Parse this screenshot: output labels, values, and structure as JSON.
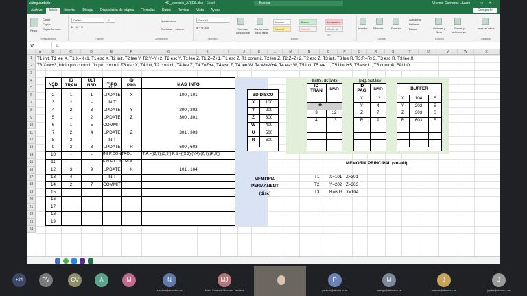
{
  "excel": {
    "title_bar": {
      "autosave": "Autoguardado",
      "file_name": "HC_ejercicio_ARIES.xlsx - Excel",
      "search_placeholder": "Buscar",
      "user": "Vicente Carneros Lázaro"
    },
    "tabs": [
      "Archivo",
      "Inicio",
      "Insertar",
      "Dibujar",
      "Disposición de página",
      "Fórmulas",
      "Datos",
      "Revisar",
      "Vista",
      "Ayuda"
    ],
    "share_label": "Compartir",
    "ribbon": {
      "clipboard": {
        "paste": "Pegar",
        "cut": "Cortar",
        "copy": "Copiar",
        "format_painter": "Copiar formato",
        "label": "Portapapeles"
      },
      "font": {
        "name": "Calibri",
        "size": "11",
        "label": "Fuente"
      },
      "alignment": {
        "wrap": "Ajustar texto",
        "merge": "Combinar y centrar",
        "label": "Alineación"
      },
      "number": {
        "format": "General",
        "label": "Número"
      },
      "styles": {
        "normal": "Normal",
        "bueno": "Bueno",
        "incorrecto": "Incorrecto",
        "neutral": "Neutral",
        "calculo": "Cálculo",
        "celda_vinculada": "Celda de co...",
        "cond_format": "Formato condicional",
        "as_table": "Dar formato como tabla",
        "label": "Estilos"
      },
      "cells": {
        "insert": "Insertar",
        "delete": "Eliminar",
        "format": "Formato",
        "label": "Celdas"
      },
      "editing": {
        "autosum": "Autosuma",
        "fill": "Rellenar",
        "clear": "Borrar",
        "sort": "Ordenar y filtrar",
        "find": "Buscar y seleccionar",
        "label": "Edición"
      },
      "analyze": {
        "label": "Analizar datos",
        "group": "Análisis"
      }
    },
    "name_box": "N7",
    "fx": "fx",
    "columns": [
      "A",
      "B",
      "C",
      "D",
      "E",
      "F",
      "G",
      "H",
      "I",
      "J",
      "K",
      "L",
      "M",
      "N",
      "O",
      "P",
      "Q",
      "R",
      "S",
      "T",
      "U",
      "V",
      "W",
      "X"
    ],
    "rows": [
      "1",
      "2",
      "3",
      "4",
      "5",
      "6",
      "7",
      "8",
      "9",
      "10",
      "11",
      "12",
      "13",
      "14",
      "15",
      "16",
      "17",
      "18",
      "19",
      "20",
      "21",
      "22",
      "23",
      "24"
    ],
    "line1": "T1 init, T1 lee X, T1:X=X+1, T1 esc X, T2 init, T2 lee Y, T2:Y=Y+2, T2 esc Y, T1 lee Z, T1:Z=Z+1, T1 esc Z, T1 commit, T2 lee Z, T2:Z=Z+2, T2 esc Z, T3 init, T3 lee R, T3:R=R+3, T3 esc R, T3 lee X,",
    "line2": "T3:X=X+3, inicio pto.control, fin pto.control, T3 esc X, T4 init, T2 commit, T4 lee Z, T4:Z=Z+4, T4 esc Z, T4 lee W, T4:W=W+4, T4 esc W, T5 init, T5 lee U, T5:U=U+5, T5 esc U, T5 commit, FALLO",
    "log_table": {
      "headers": [
        "NSD",
        "ID\nTRAN",
        "ULT\nNSD",
        "TIPO",
        "ID\nPAG",
        "MAS_INFO"
      ],
      "header_lines": [
        [
          "NSD"
        ],
        [
          "ID",
          "TRAN"
        ],
        [
          "ULT",
          "NSD"
        ],
        [
          "TIPO"
        ],
        [
          "ID",
          "PAG"
        ],
        [
          "MAS_INFO"
        ]
      ],
      "rows": [
        [
          "1",
          "1",
          "-",
          "INIT",
          "",
          ""
        ],
        [
          "2",
          "1",
          "1",
          "UPDATE",
          "X",
          "100 , 101"
        ],
        [
          "3",
          "2",
          "-",
          "INIT",
          "",
          ""
        ],
        [
          "4",
          "2",
          "3",
          "UPDATE",
          "Y",
          "200 , 202"
        ],
        [
          "5",
          "1",
          "2",
          "UPDATE",
          "Z",
          "300 , 301"
        ],
        [
          "6",
          "1",
          "5",
          "COMMIT",
          "",
          ""
        ],
        [
          "7",
          "2",
          "4",
          "UPDATE",
          "Z",
          "301 , 303"
        ],
        [
          "8",
          "3",
          "-",
          "INIT",
          "",
          ""
        ],
        [
          "9",
          "3",
          "8",
          "UPDATE",
          "R",
          "600 , 603"
        ],
        [
          "10",
          "-",
          "-",
          "INI P.CONTROL",
          "",
          "T.A.={(2,7),(3,9)} P.S.={(X,2),(Y,4),(Z,7),(R,9)}"
        ],
        [
          "11",
          "-",
          "-",
          "FIN P.CONTROL",
          "",
          ""
        ],
        [
          "12",
          "3",
          "9",
          "UPDATE",
          "X",
          "101 , 104"
        ],
        [
          "13",
          "4",
          "-",
          "INIT",
          "",
          ""
        ],
        [
          "14",
          "2",
          "7",
          "COMMIT",
          "",
          ""
        ],
        [
          "15",
          "",
          "",
          "",
          "",
          ""
        ],
        [
          "16",
          "",
          "",
          "",
          "",
          ""
        ],
        [
          "17",
          "",
          "",
          "",
          "",
          ""
        ],
        [
          "18",
          "",
          "",
          "",
          "",
          ""
        ],
        [
          "19",
          "",
          "",
          "",
          "",
          ""
        ]
      ]
    },
    "bd_disco": {
      "title": "BD DISCO",
      "rows": [
        [
          "X",
          "100"
        ],
        [
          "Y",
          "200"
        ],
        [
          "Z",
          "300"
        ],
        [
          "W",
          "400"
        ],
        [
          "U",
          "500"
        ],
        [
          "R",
          "600"
        ]
      ]
    },
    "memoria_permanente": [
      "MEMORIA",
      "PERMANENT",
      "(disc)"
    ],
    "trans_activas": {
      "title": "trans. activas",
      "headers": [
        [
          "ID",
          "TRAN"
        ],
        [
          "NSD"
        ]
      ],
      "rows": [
        [
          "",
          ""
        ],
        [
          "",
          ""
        ],
        [
          "3",
          "12"
        ],
        [
          "4",
          "13"
        ],
        [
          "",
          ""
        ],
        [
          "",
          ""
        ],
        [
          "",
          ""
        ]
      ]
    },
    "pag_sucias": {
      "title": "pag. sucias",
      "headers": [
        [
          "ID",
          "PAG"
        ],
        [
          "NSD"
        ]
      ],
      "rows": [
        [
          "X",
          "12"
        ],
        [
          "Y",
          "4"
        ],
        [
          "Z",
          "7"
        ],
        [
          "R",
          "9"
        ],
        [
          "",
          ""
        ],
        [
          "",
          ""
        ],
        [
          "",
          ""
        ]
      ]
    },
    "buffer": {
      "title": "BUFFER",
      "rows": [
        [
          "X",
          "104",
          "S"
        ],
        [
          "Y",
          "202",
          "S"
        ],
        [
          "Z",
          "303",
          "S"
        ],
        [
          "R",
          "603",
          "S"
        ],
        [
          "",
          "",
          ""
        ],
        [
          "",
          "",
          ""
        ],
        [
          "",
          "",
          ""
        ]
      ]
    },
    "memoria_principal": {
      "title": "MEMORIA PRINCIPAL (volátil)",
      "rows": [
        [
          "T1",
          "X=101",
          "Z=301"
        ],
        [
          "T2",
          "Y=202",
          "Z=303"
        ],
        [
          "T3",
          "R=603",
          "X=104"
        ]
      ]
    }
  },
  "meeting": {
    "overflow": "+24",
    "participants": [
      {
        "initials": "PV",
        "color": "#7b7b7b",
        "name": ""
      },
      {
        "initials": "GV",
        "color": "#8e8e6a",
        "name": ""
      },
      {
        "initials": "A",
        "color": "#5aa58a",
        "name": ""
      },
      {
        "initials": "M",
        "color": "#c06a8e",
        "name": ""
      },
      {
        "initials": "N",
        "color": "#5f7aa8",
        "name": "zaschna@alumni.uv.es"
      },
      {
        "initials": "MJ",
        "color": "#b07878",
        "name": "María Consuelo Manzano Jabalera"
      },
      {
        "initials": "",
        "color": "#555",
        "name": ""
      },
      {
        "initials": "P",
        "color": "#6a82b5",
        "name": "paulvain@alumni.uv.es"
      },
      {
        "initials": "M",
        "color": "#7b8a9b",
        "name": "miesge@alumni.uv.es"
      },
      {
        "initials": "J",
        "color": "#c8a45a",
        "name": "jortecer@alumni.uv.es"
      },
      {
        "initials": "J",
        "color": "#9a9a9a",
        "name": "japfter@alumni.uv.es"
      }
    ]
  }
}
